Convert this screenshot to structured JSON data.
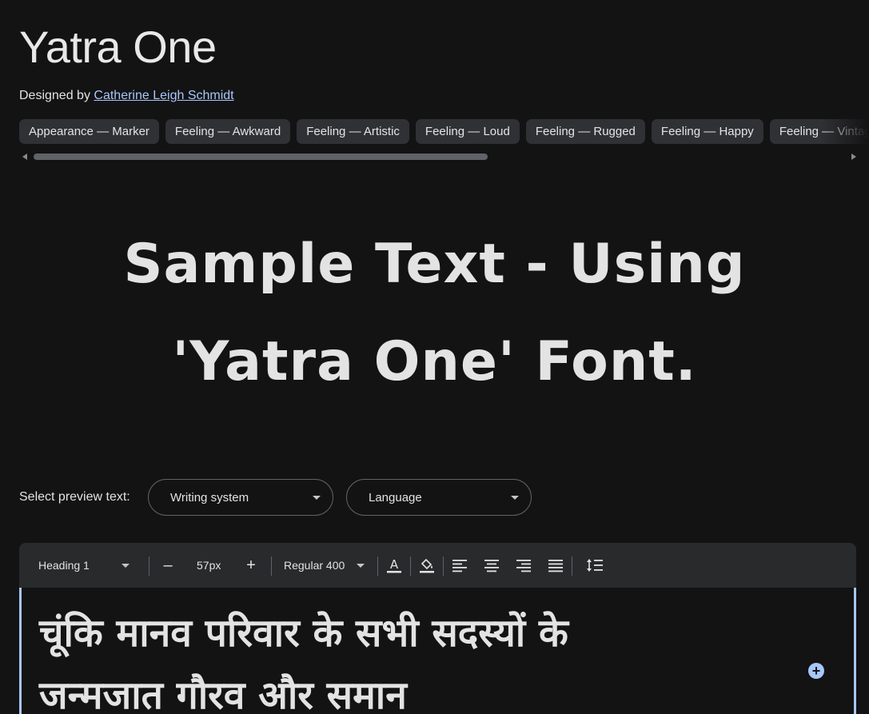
{
  "font": {
    "name": "Yatra One",
    "designed_by_prefix": "Designed by",
    "designer": "Catherine Leigh Schmidt"
  },
  "tags": [
    "Appearance — Marker",
    "Feeling — Awkward",
    "Feeling — Artistic",
    "Feeling — Loud",
    "Feeling — Rugged",
    "Feeling — Happy",
    "Feeling — Vintage"
  ],
  "sample": {
    "line1": "Sample Text - Using",
    "line2": "'Yatra One' Font."
  },
  "preview": {
    "label": "Select preview text:",
    "writing_system": "Writing system",
    "language": "Language"
  },
  "toolbar": {
    "style": "Heading 1",
    "size": "57px",
    "weight": "Regular 400",
    "decrease": "–",
    "increase": "+"
  },
  "editor": {
    "line1": "चूंकि मानव परिवार के सभी सदस्यों के",
    "line2": "जन्मजात गौरव और समान"
  },
  "colors": {
    "background": "#131314",
    "chip": "#303134",
    "link": "#a8c7fa",
    "toolbar": "#282a2c"
  }
}
